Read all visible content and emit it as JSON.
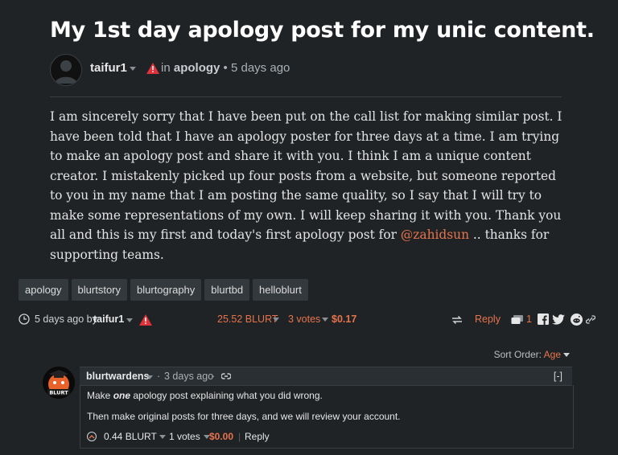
{
  "post": {
    "title": "My 1st day apology post for my unic content.",
    "author": "taifur1",
    "in_label": "in",
    "category": "apology",
    "age": "5 days ago",
    "body_main": "I am sincerely sorry that I have been put on the call list for making similar post. I have been told that I have an apology poster for three days at a time. I am trying to make an apology post and share it with you. I think I am a unique content creator. I mistakenly picked up four posts from a website, but someone reported to you in my name that I am posting the same quality, so I say that I will try to make some representations of my own. I will keep sharing it with you. Thank you all and this is my first and today's first apology post for ",
    "mention": "@zahidsun",
    "body_end": " .. thanks for supporting teams."
  },
  "tags": [
    "apology",
    "blurtstory",
    "blurtography",
    "blurtbd",
    "helloblurt"
  ],
  "footer": {
    "time": "5 days ago by",
    "author": "taifur1",
    "payout": "25.52 BLURT",
    "votes": "3 votes",
    "value": "$0.17",
    "reply": "Reply",
    "comment_count": "1"
  },
  "sort": {
    "label": "Sort Order:",
    "value": "Age"
  },
  "comment": {
    "author": "blurtwardens",
    "age": "3 days ago",
    "collapse": "[-]",
    "line1_pre": "Make ",
    "line1_em": "one",
    "line1_post": " apology post explaining what you did wrong.",
    "line2": "Then make original posts for three days, and we will review your account.",
    "payout": "0.44 BLURT",
    "votes": "1 votes",
    "value": "$0.00",
    "reply": "Reply",
    "avatar_text": "BLURT"
  },
  "colors": {
    "accent": "#e8734b",
    "background": "#1f2326",
    "warning": "#e0323a"
  }
}
